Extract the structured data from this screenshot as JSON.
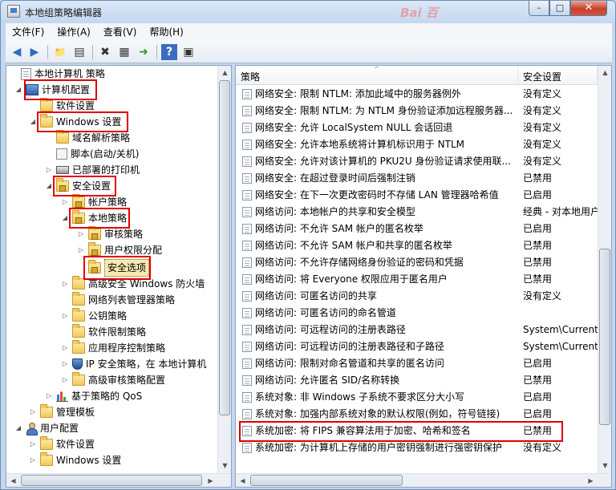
{
  "window": {
    "title": "本地组策略编辑器",
    "watermark": "Bai 百",
    "min_glyph": "–",
    "max_glyph": "□",
    "close_glyph": "✕"
  },
  "menu": [
    {
      "label": "文件(F)"
    },
    {
      "label": "操作(A)"
    },
    {
      "label": "查看(V)"
    },
    {
      "label": "帮助(H)"
    }
  ],
  "toolbar": {
    "back": "◀",
    "forward": "▶",
    "up": "📁",
    "show_hide": "▤",
    "delete": "✖",
    "properties": "▦",
    "export": "➜",
    "help": "?",
    "view": "▣"
  },
  "tree": [
    {
      "label": "本地计算机 策略",
      "icon": "doc-icon",
      "expander": ""
    },
    {
      "label": "计算机配置",
      "icon": "computer-icon",
      "expander": "◢"
    },
    {
      "label": "软件设置",
      "icon": "folder-icon",
      "expander": ""
    },
    {
      "label": "Windows 设置",
      "icon": "folder-icon",
      "expander": "◢"
    },
    {
      "label": "域名解析策略",
      "icon": "folder-icon",
      "expander": ""
    },
    {
      "label": "脚本(启动/关机)",
      "icon": "script-icon",
      "expander": ""
    },
    {
      "label": "已部署的打印机",
      "icon": "printer-icon",
      "expander": "▷"
    },
    {
      "label": "安全设置",
      "icon": "lock-folder-icon",
      "expander": "◢"
    },
    {
      "label": "帐户策略",
      "icon": "lock-folder-icon",
      "expander": "▷"
    },
    {
      "label": "本地策略",
      "icon": "lock-folder-icon",
      "expander": "◢"
    },
    {
      "label": "审核策略",
      "icon": "lock-folder-icon",
      "expander": "▷"
    },
    {
      "label": "用户权限分配",
      "icon": "lock-folder-icon",
      "expander": "▷"
    },
    {
      "label": "安全选项",
      "icon": "lock-folder-icon",
      "expander": ""
    },
    {
      "label": "高级安全 Windows 防火墙",
      "icon": "folder-icon",
      "expander": "▷"
    },
    {
      "label": "网络列表管理器策略",
      "icon": "folder-icon",
      "expander": ""
    },
    {
      "label": "公钥策略",
      "icon": "folder-icon",
      "expander": "▷"
    },
    {
      "label": "软件限制策略",
      "icon": "folder-icon",
      "expander": ""
    },
    {
      "label": "应用程序控制策略",
      "icon": "folder-icon",
      "expander": "▷"
    },
    {
      "label": "IP 安全策略，在 本地计算机",
      "icon": "shield-icon",
      "expander": "▷"
    },
    {
      "label": "高级审核策略配置",
      "icon": "folder-icon",
      "expander": "▷"
    },
    {
      "label": "基于策略的 QoS",
      "icon": "chart-icon",
      "expander": "▷"
    },
    {
      "label": "管理模板",
      "icon": "folder-icon",
      "expander": "▷"
    },
    {
      "label": "用户配置",
      "icon": "user-icon",
      "expander": "◢"
    },
    {
      "label": "软件设置",
      "icon": "folder-icon",
      "expander": "▷"
    },
    {
      "label": "Windows 设置",
      "icon": "folder-icon",
      "expander": "▷"
    }
  ],
  "list": {
    "headers": {
      "policy": "策略",
      "setting": "安全设置",
      "sort_glyph": "^"
    },
    "rows": [
      {
        "policy": "网络安全: 限制 NTLM: 添加此域中的服务器例外",
        "setting": "没有定义"
      },
      {
        "policy": "网络安全: 限制 NTLM: 为 NTLM 身份验证添加远程服务器...",
        "setting": "没有定义"
      },
      {
        "policy": "网络安全: 允许 LocalSystem NULL 会话回退",
        "setting": "没有定义"
      },
      {
        "policy": "网络安全: 允许本地系统将计算机标识用于 NTLM",
        "setting": "没有定义"
      },
      {
        "policy": "网络安全: 允许对该计算机的 PKU2U 身份验证请求使用联...",
        "setting": "没有定义"
      },
      {
        "policy": "网络安全: 在超过登录时间后强制注销",
        "setting": "已禁用"
      },
      {
        "policy": "网络安全: 在下一次更改密码时不存储 LAN 管理器哈希值",
        "setting": "已启用"
      },
      {
        "policy": "网络访问: 本地帐户的共享和安全模型",
        "setting": "经典 - 对本地用户"
      },
      {
        "policy": "网络访问: 不允许 SAM 帐户的匿名枚举",
        "setting": "已启用"
      },
      {
        "policy": "网络访问: 不允许 SAM 帐户和共享的匿名枚举",
        "setting": "已禁用"
      },
      {
        "policy": "网络访问: 不允许存储网络身份验证的密码和凭据",
        "setting": "已禁用"
      },
      {
        "policy": "网络访问: 将 Everyone 权限应用于匿名用户",
        "setting": "已禁用"
      },
      {
        "policy": "网络访问: 可匿名访问的共享",
        "setting": "没有定义"
      },
      {
        "policy": "网络访问: 可匿名访问的命名管道",
        "setting": ""
      },
      {
        "policy": "网络访问: 可远程访问的注册表路径",
        "setting": "System\\CurrentC"
      },
      {
        "policy": "网络访问: 可远程访问的注册表路径和子路径",
        "setting": "System\\CurrentC"
      },
      {
        "policy": "网络访问: 限制对命名管道和共享的匿名访问",
        "setting": "已启用"
      },
      {
        "policy": "网络访问: 允许匿名 SID/名称转换",
        "setting": "已禁用"
      },
      {
        "policy": "系统对象: 非 Windows 子系统不要求区分大小写",
        "setting": "已启用"
      },
      {
        "policy": "系统对象: 加强内部系统对象的默认权限(例如，符号链接)",
        "setting": "已启用"
      },
      {
        "policy": "系统加密: 将 FIPS 兼容算法用于加密、哈希和签名",
        "setting": "已禁用"
      },
      {
        "policy": "系统加密: 为计算机上存储的用户密钥强制进行强密钥保护",
        "setting": "没有定义"
      }
    ]
  }
}
